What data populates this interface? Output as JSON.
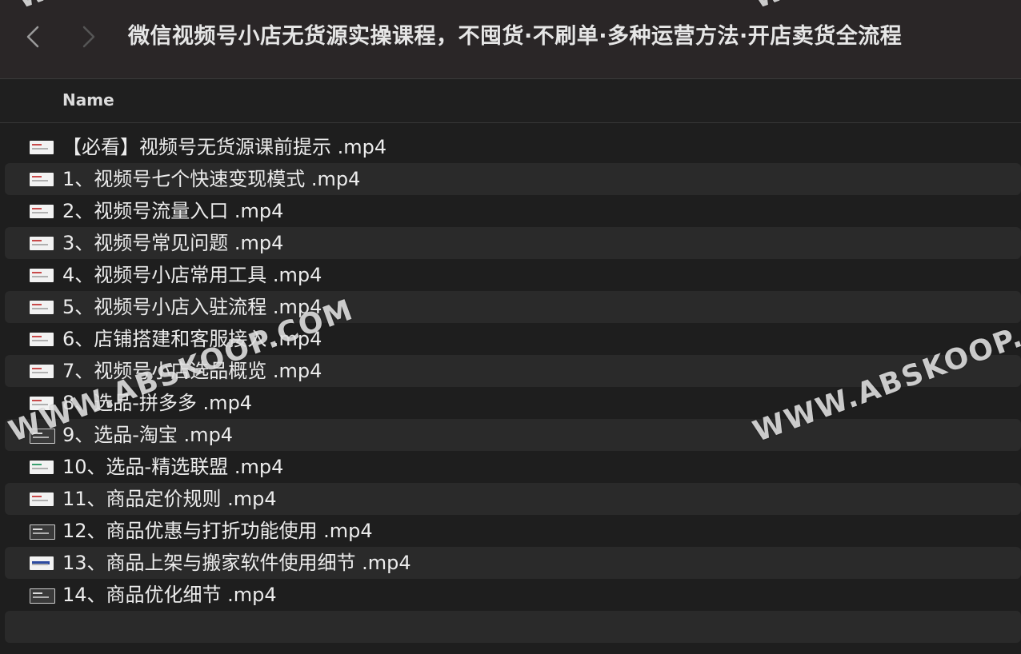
{
  "window": {
    "title": "微信视频号小店无货源实操课程，不囤货·不刷单·多种运营方法·开店卖货全流程"
  },
  "columns": {
    "name": "Name"
  },
  "files": [
    {
      "name": "【必看】视频号无货源课前提示 .mp4"
    },
    {
      "name": "1、视频号七个快速变现模式 .mp4"
    },
    {
      "name": "2、视频号流量入口 .mp4"
    },
    {
      "name": "3、视频号常见问题 .mp4"
    },
    {
      "name": "4、视频号小店常用工具 .mp4"
    },
    {
      "name": "5、视频号小店入驻流程 .mp4"
    },
    {
      "name": "6、店铺搭建和客服接入 .mp4"
    },
    {
      "name": "7、视频号小店选品概览 .mp4"
    },
    {
      "name": "8、选品-拼多多 .mp4"
    },
    {
      "name": "9、选品-淘宝 .mp4"
    },
    {
      "name": "10、选品-精选联盟 .mp4"
    },
    {
      "name": "11、商品定价规则 .mp4"
    },
    {
      "name": "12、商品优惠与打折功能使用 .mp4"
    },
    {
      "name": "13、商品上架与搬家软件使用细节 .mp4"
    },
    {
      "name": "14、商品优化细节 .mp4"
    }
  ],
  "watermark": {
    "text": "WWW.ABSKOOP.COM",
    "text_right": "WWW.ABSKOOP.C",
    "text_top": "WWW."
  },
  "colors": {
    "background": "#1e1e1e",
    "toolbar": "#2a2627",
    "row_alt": "#2a2a2a",
    "text": "#ececec"
  }
}
